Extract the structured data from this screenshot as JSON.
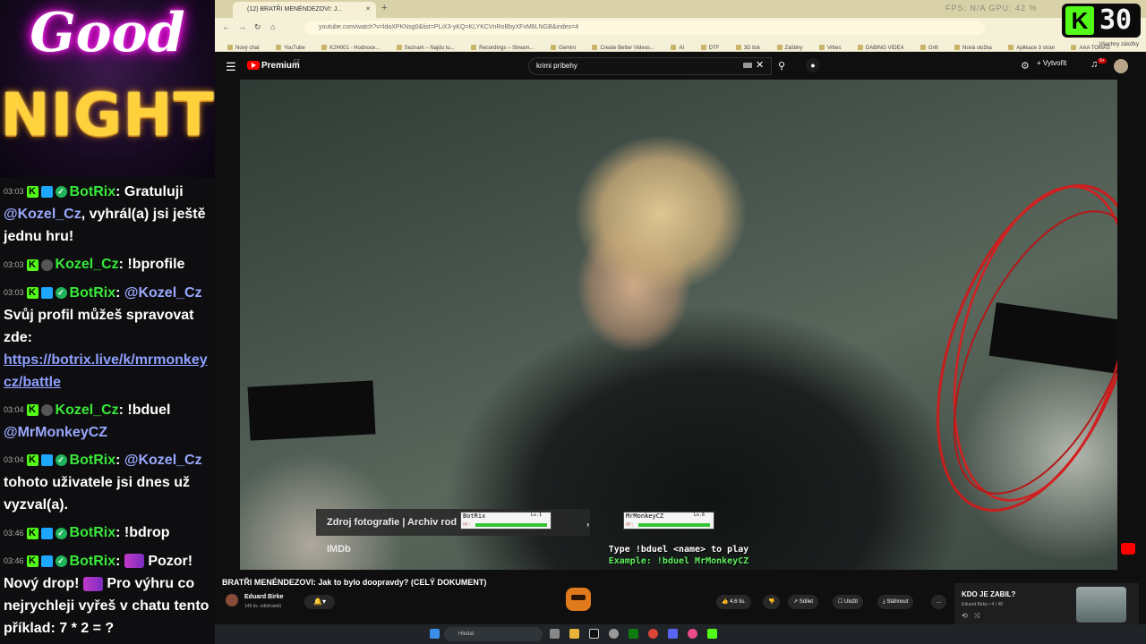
{
  "overlay": {
    "logo_top": "Good",
    "logo_bottom": "NIGHT",
    "kick_badge_letter": "K",
    "kick_badge_number": "30"
  },
  "chat": {
    "messages": [
      {
        "time": "03:03",
        "user": "BotRix",
        "text_parts": [
          ": Gratuluji ",
          "@Kozel_Cz",
          ", vyhrál(a) jsi ještě jednu hru!"
        ]
      },
      {
        "time": "03:03",
        "user": "Kozel_Cz",
        "text_parts": [
          ": !bprofile"
        ]
      },
      {
        "time": "03:03",
        "user": "BotRix",
        "text_parts": [
          ": ",
          "@Kozel_Cz",
          " Svůj profil můžeš spravovat zde: ",
          "https://botrix.live/k/mrmonkeycz/battle"
        ]
      },
      {
        "time": "03:04",
        "user": "Kozel_Cz",
        "text_parts": [
          ": !bduel ",
          "@MrMonkeyCZ"
        ]
      },
      {
        "time": "03:04",
        "user": "BotRix",
        "text_parts": [
          ": ",
          "@Kozel_Cz",
          " tohoto uživatele jsi dnes už vyzval(a)."
        ]
      },
      {
        "time": "03:46",
        "user": "BotRix",
        "text_parts": [
          ": !bdrop"
        ]
      },
      {
        "time": "03:46",
        "user": "BotRix",
        "text_parts": [
          ": ",
          "Pozor! Nový drop! ",
          "Pro výhru co nejrychleji vyřeš v chatu tento příklad: 7 * 2 = ?"
        ]
      }
    ]
  },
  "browser": {
    "tab_title": "(12) BRATŘI MENÉNDEZOVI: J...",
    "tab_stats": "FPS: N/A   GPU: 42 %",
    "url": "youtube.com/watch?v=ldaXPKNsg0&list=PLiX3-yKQ=KLYKCVnRoBbyXFxM6LNGB&index=4",
    "bookmarks": [
      "Nový chat",
      "YouTube",
      "K2H001 - Hodnoce...",
      "Seznam – Najdu tu...",
      "Recordings – Stream...",
      "Gemini",
      "Create Better Videos...",
      "AI",
      "DTF",
      "3D tisk",
      "Zaštěry",
      "Vrbes",
      "DABING VIDEA",
      "Grill",
      "Nová složka",
      "Aplikace 3 stran",
      "AAA TOMÁŠ"
    ],
    "all_bookmarks": "Všechny záložky"
  },
  "youtube": {
    "logo_text": "Premium",
    "region": "CZ",
    "search_value": "krimi príbehy",
    "create_label": "Vytvořit",
    "notif_count": "9+",
    "video": {
      "caption": "Zdroj fotografie | Archiv rod",
      "caption_suffix": ", IMDb",
      "duel_player1": {
        "name": "BotRix",
        "level": "Lv.1",
        "hp_label": "HP:",
        "hp_fraction": 1.0
      },
      "duel_player2": {
        "name": "MrMonkeyCZ",
        "level": "Lv.6",
        "hp_label": "HP:",
        "hp_fraction": 1.0
      },
      "duel_instructions": "Type !bduel <name> to play",
      "duel_example": "Example: !bduel MrMonkeyCZ"
    },
    "title": "BRATŘI MENÉNDEZOVI: Jak to bylo doopravdy? (CELÝ DOKUMENT)",
    "channel_name": "Eduard Birke",
    "channel_subs": "145 tis. odběratelů",
    "likes": "4,6 tis.",
    "share_label": "Sdílet",
    "save_label": "Uložit",
    "download_label": "Stáhnout",
    "more_label": "...",
    "playlist_card": {
      "title": "KDO JE ZABIL?",
      "subtitle": "Eduard Birke • 4 / 48"
    }
  },
  "taskbar": {
    "search_placeholder": "Hledat"
  },
  "colors": {
    "kick_green": "#53fc18",
    "user_green": "#39e93a",
    "mention": "#9aa8ff",
    "youtube_red": "#ff0000"
  }
}
